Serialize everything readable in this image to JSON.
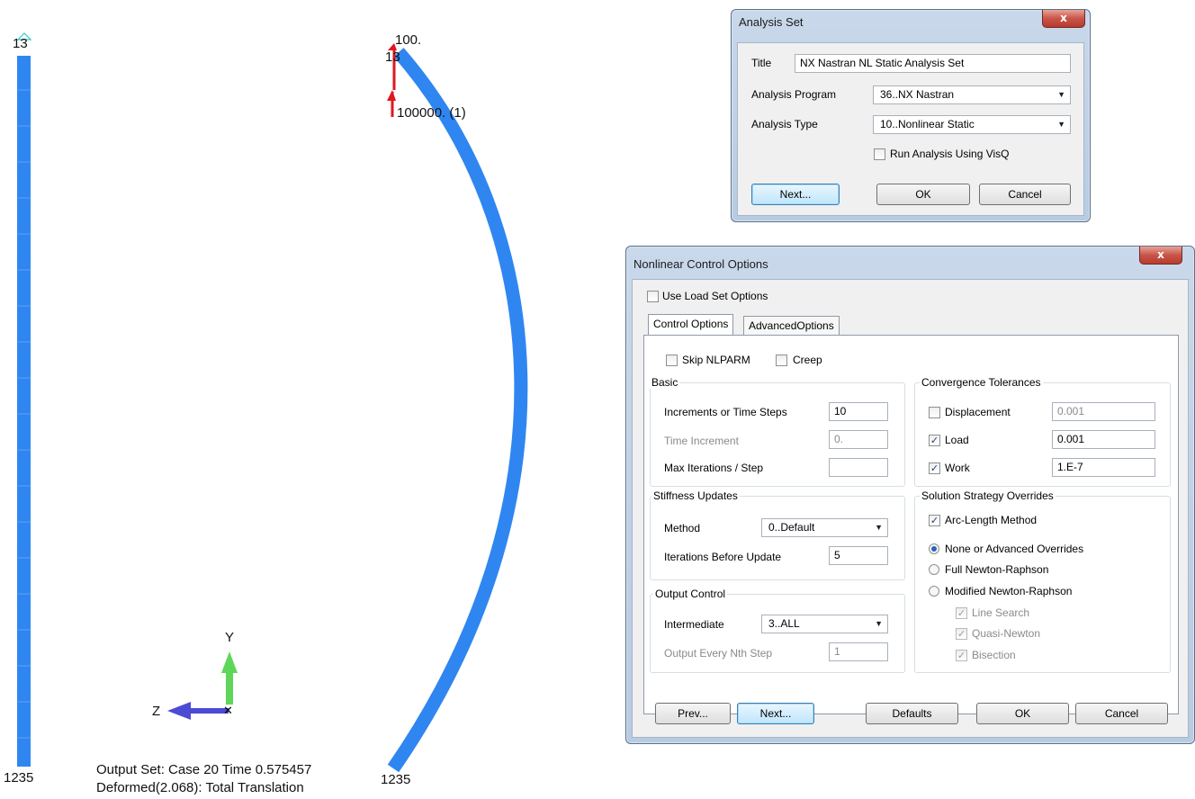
{
  "viewport": {
    "left_top_node": "13",
    "left_bottom_node": "1235",
    "right_top_node": "13",
    "right_bottom_node": "1235",
    "load_label_top": "100.",
    "load_label_mid": "100000. (1)",
    "axis_y": "Y",
    "axis_z": "Z",
    "axis_x": "X",
    "output_set_line": "Output Set: Case 20 Time 0.575457",
    "deformed_line": "Deformed(2.068): Total Translation",
    "colors": {
      "beam": "#2f86f0",
      "load": "#e0171f",
      "axis_y": "#5fd65a",
      "axis_z": "#4b4bd4"
    }
  },
  "analysis_set": {
    "title": "Analysis Set",
    "close_glyph": "x",
    "title_label": "Title",
    "title_value": "NX Nastran NL Static Analysis Set",
    "program_label": "Analysis Program",
    "program_value": "36..NX Nastran",
    "type_label": "Analysis Type",
    "type_value": "10..Nonlinear Static",
    "visq_label": "Run Analysis Using VisQ",
    "visq_checked": false,
    "next_button": "Next...",
    "ok_button": "OK",
    "cancel_button": "Cancel"
  },
  "nonlinear": {
    "title": "Nonlinear Control Options",
    "close_glyph": "x",
    "use_load_set": "Use Load Set Options",
    "tabs": [
      "Control Options",
      "AdvancedOptions"
    ],
    "skip_nlparm": "Skip NLPARM",
    "creep": "Creep",
    "basic": {
      "title": "Basic",
      "increments_label": "Increments or Time Steps",
      "increments_value": "10",
      "time_increment_label": "Time Increment",
      "time_increment_value": "0.",
      "max_iter_label": "Max Iterations / Step",
      "max_iter_value": ""
    },
    "stiffness": {
      "title": "Stiffness Updates",
      "method_label": "Method",
      "method_value": "0..Default",
      "iter_before_label": "Iterations Before Update",
      "iter_before_value": "5"
    },
    "output": {
      "title": "Output Control",
      "intermediate_label": "Intermediate",
      "intermediate_value": "3..ALL",
      "every_nth_label": "Output Every Nth Step",
      "every_nth_value": "1"
    },
    "convergence": {
      "title": "Convergence Tolerances",
      "displacement_label": "Displacement",
      "displacement_value": "0.001",
      "displacement_checked": false,
      "load_label": "Load",
      "load_value": "0.001",
      "load_checked": true,
      "work_label": "Work",
      "work_value": "1.E-7",
      "work_checked": true
    },
    "strategy": {
      "title": "Solution Strategy Overrides",
      "arc_length": "Arc-Length Method",
      "arc_length_checked": true,
      "radio_none": "None or Advanced Overrides",
      "radio_full": "Full Newton-Raphson",
      "radio_modified": "Modified Newton-Raphson",
      "selected": "None or Advanced Overrides",
      "line_search": "Line Search",
      "quasi_newton": "Quasi-Newton",
      "bisection": "Bisection"
    },
    "buttons": {
      "prev": "Prev...",
      "next": "Next...",
      "defaults": "Defaults",
      "ok": "OK",
      "cancel": "Cancel"
    }
  }
}
